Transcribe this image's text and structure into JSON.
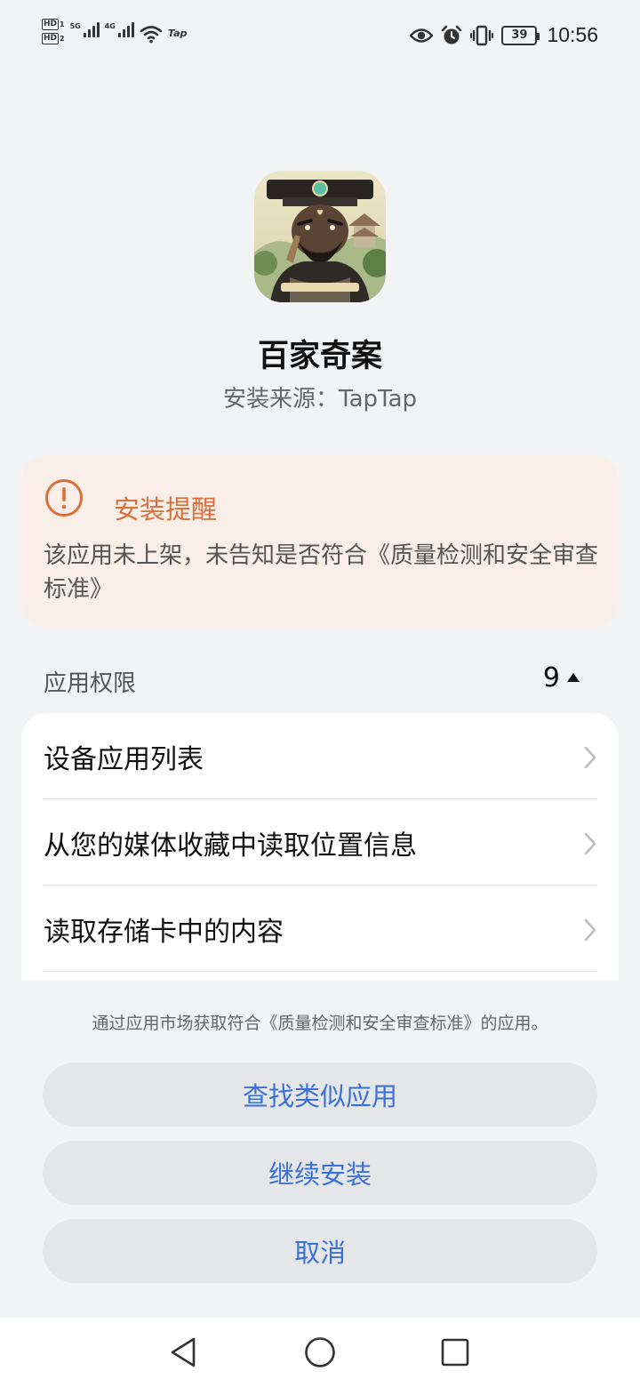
{
  "status_bar": {
    "hd1": "HD",
    "hd1_num": "1",
    "hd2": "HD",
    "hd2_num": "2",
    "net1": "5G",
    "net2": "4G",
    "tap_badge": "Tap",
    "battery": "39",
    "time": "10:56",
    "icons": [
      "eye-icon",
      "alarm-icon",
      "vibrate-icon",
      "battery-icon",
      "wifi-icon",
      "signal-icon"
    ]
  },
  "app": {
    "name": "百家奇案",
    "source": "安装来源：TapTap"
  },
  "warning": {
    "title": "安装提醒",
    "body": "该应用未上架，未告知是否符合《质量检测和安全审查标准》",
    "color": "#D9703C",
    "background": "#FAEEE8"
  },
  "permissions": {
    "header": "应用权限",
    "count": "9",
    "items": [
      {
        "label": "设备应用列表"
      },
      {
        "label": "从您的媒体收藏中读取位置信息"
      },
      {
        "label": "读取存储卡中的内容"
      }
    ]
  },
  "note": "通过应用市场获取符合《质量检测和安全审查标准》的应用。",
  "buttons": {
    "find_similar": "查找类似应用",
    "continue_install": "继续安装",
    "cancel": "取消"
  },
  "colors": {
    "accent": "#3A70D9",
    "background": "#F1F3F5"
  }
}
